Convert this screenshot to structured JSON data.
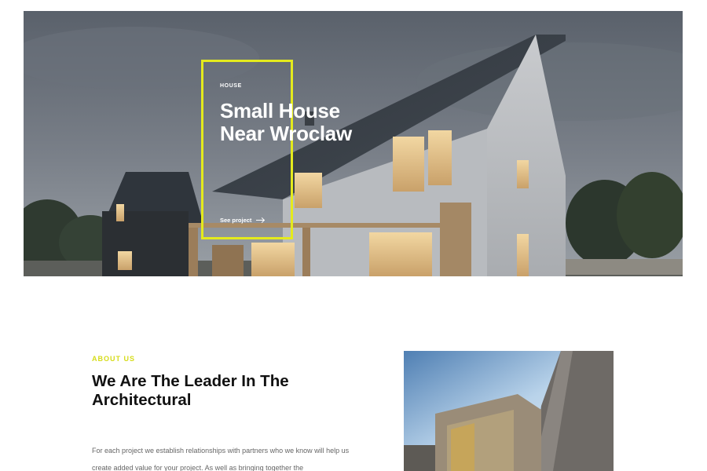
{
  "hero": {
    "tag": "HOUSE",
    "title": "Small House Near Wroclaw",
    "link_label": "See project"
  },
  "about": {
    "eyebrow": "ABOUT US",
    "heading": "We Are The Leader In The Architectural",
    "text": "For each project we establish relationships with partners who we know will help us create added value for your project. As well as bringing together the"
  },
  "colors": {
    "accent": "#e4ea1d",
    "heading": "#111111",
    "body_text": "#666666"
  }
}
